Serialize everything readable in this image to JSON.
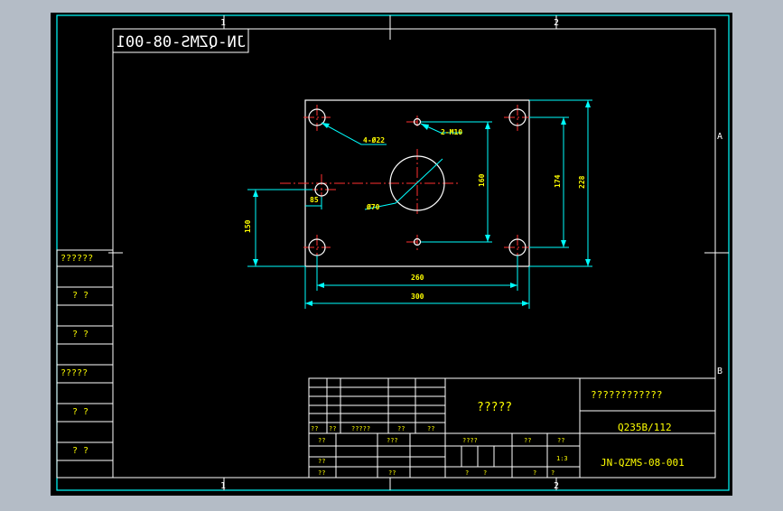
{
  "drawing": {
    "mirrored_code": "JN-QZMS-08-001",
    "zones": {
      "top_1": "1",
      "top_2": "2",
      "bottom_1": "1",
      "bottom_2": "2",
      "right_a": "A",
      "right_b": "B"
    }
  },
  "side_stamp": [
    "??????",
    "? ?",
    "? ?",
    "?????",
    "? ?",
    "? ?"
  ],
  "dimensions": {
    "holes_label": "4-Ø22",
    "thread_label": "2-M10",
    "bore_label": "Ø70",
    "offset_85": "85",
    "height_150": "150",
    "height_160": "160",
    "height_174": "174",
    "height_228": "228",
    "width_260": "260",
    "width_300": "300"
  },
  "title_block": {
    "part_name": "?????",
    "company": "????????????",
    "material": "Q235B/112",
    "drawing_number": "JN-QZMS-08-001",
    "scale": "1:3",
    "row_a": [
      "??",
      "??",
      "?????",
      "??",
      "??"
    ],
    "row_b": [
      "??",
      "???"
    ],
    "row_c": [
      "??"
    ],
    "row_d": [
      "??",
      "??"
    ],
    "mid_headers": [
      "????",
      "??",
      "??"
    ],
    "mid_bottom": [
      "?",
      "?",
      "?",
      "?"
    ]
  }
}
